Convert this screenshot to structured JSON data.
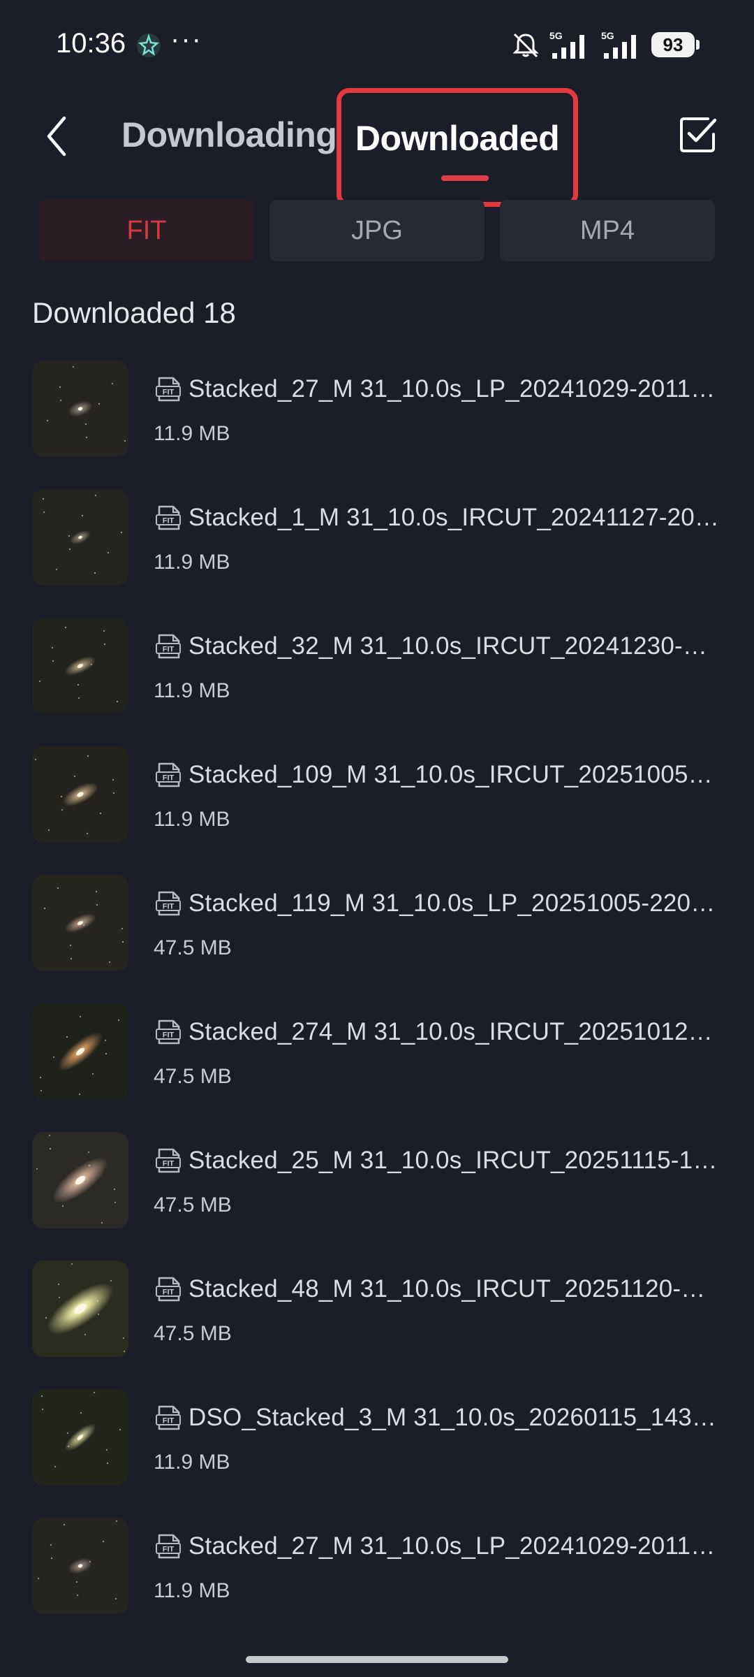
{
  "status": {
    "time": "10:36",
    "more_dots": "···",
    "battery": "93",
    "icons": [
      "app-notification-icon",
      "mute-bell-icon",
      "signal-5g-icon",
      "signal-5g-icon"
    ]
  },
  "header": {
    "tabs": [
      {
        "label": "Downloading",
        "active": false
      },
      {
        "label": "Downloaded",
        "active": true
      }
    ],
    "back_icon": "chevron-left-icon",
    "select_icon": "checkbox-icon"
  },
  "filters": [
    {
      "label": "FIT",
      "active": true
    },
    {
      "label": "JPG",
      "active": false
    },
    {
      "label": "MP4",
      "active": false
    }
  ],
  "count_label": "Downloaded 18",
  "files": [
    {
      "name": "Stacked_27_M 31_10.0s_LP_20241029-2011…",
      "size": "11.9 MB",
      "type_icon": "fit-file-icon"
    },
    {
      "name": "Stacked_1_M 31_10.0s_IRCUT_20241127-20…",
      "size": "11.9 MB",
      "type_icon": "fit-file-icon"
    },
    {
      "name": "Stacked_32_M 31_10.0s_IRCUT_20241230-…",
      "size": "11.9 MB",
      "type_icon": "fit-file-icon"
    },
    {
      "name": "Stacked_109_M 31_10.0s_IRCUT_20251005…",
      "size": "11.9 MB",
      "type_icon": "fit-file-icon"
    },
    {
      "name": "Stacked_119_M 31_10.0s_LP_20251005-220…",
      "size": "47.5 MB",
      "type_icon": "fit-file-icon"
    },
    {
      "name": "Stacked_274_M 31_10.0s_IRCUT_20251012…",
      "size": "47.5 MB",
      "type_icon": "fit-file-icon"
    },
    {
      "name": "Stacked_25_M 31_10.0s_IRCUT_20251115-1…",
      "size": "47.5 MB",
      "type_icon": "fit-file-icon"
    },
    {
      "name": "Stacked_48_M 31_10.0s_IRCUT_20251120-…",
      "size": "47.5 MB",
      "type_icon": "fit-file-icon"
    },
    {
      "name": "DSO_Stacked_3_M 31_10.0s_20260115_143…",
      "size": "11.9 MB",
      "type_icon": "fit-file-icon"
    },
    {
      "name": "Stacked_27_M 31_10.0s_LP_20241029-2011…",
      "size": "11.9 MB",
      "type_icon": "fit-file-icon"
    }
  ],
  "colors": {
    "background": "#1b1d28",
    "accent": "#e23e48",
    "highlight_box": "#e4393f",
    "chip_bg": "#272a35",
    "chip_active_bg": "#2c1d25"
  }
}
